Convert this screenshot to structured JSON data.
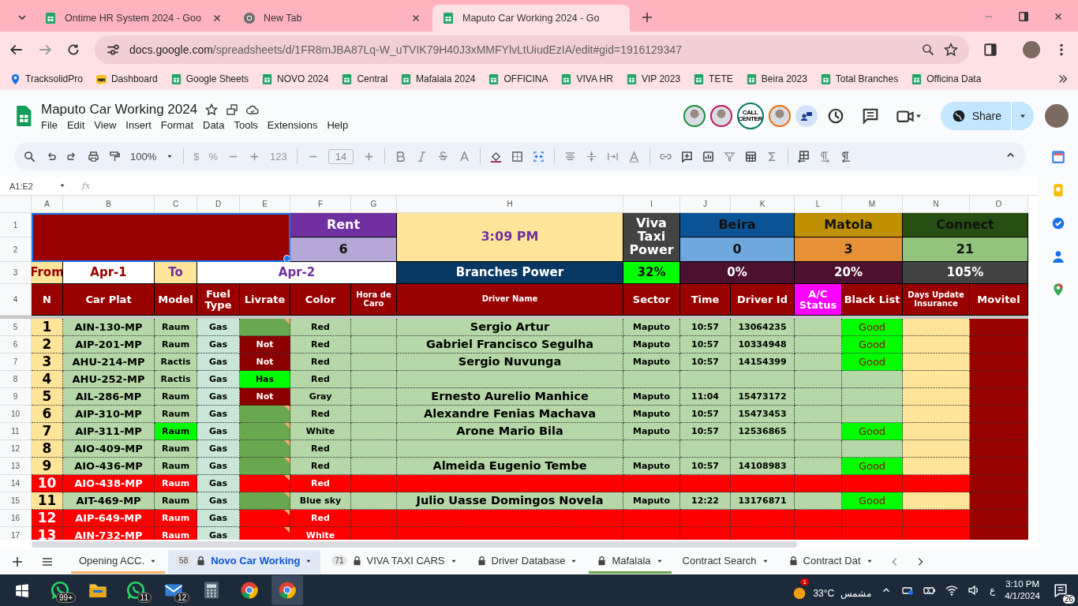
{
  "browser": {
    "tabs": [
      {
        "title": "Ontime HR System 2024 - Goo",
        "kind": "sheets",
        "selected": false
      },
      {
        "title": "New Tab",
        "kind": "chrome",
        "selected": false
      },
      {
        "title": "Maputo Car Working 2024 - Go",
        "kind": "sheets",
        "selected": true
      }
    ],
    "url": {
      "domain": "docs.google.com",
      "path": "/spreadsheets/d/1FR8mJBA87Lq-W_uTVIK79H40J3xMMFYlvLtUiudEzIA/edit#gid=1916129347"
    },
    "bookmarks": [
      {
        "label": "TracksolidPro",
        "kind": "location"
      },
      {
        "label": "Dashboard",
        "kind": "taxi"
      },
      {
        "label": "Google Sheets",
        "kind": "sheets"
      },
      {
        "label": "NOVO 2024",
        "kind": "sheets"
      },
      {
        "label": "Central",
        "kind": "sheets"
      },
      {
        "label": "Mafalala 2024",
        "kind": "sheets"
      },
      {
        "label": "OFFICINA",
        "kind": "sheets"
      },
      {
        "label": "VIVA HR",
        "kind": "sheets"
      },
      {
        "label": "VIP 2023",
        "kind": "sheets"
      },
      {
        "label": "TETE",
        "kind": "sheets"
      },
      {
        "label": "Beira 2023",
        "kind": "sheets"
      },
      {
        "label": "Total Branches",
        "kind": "sheets"
      },
      {
        "label": "Officina Data",
        "kind": "sheets"
      }
    ]
  },
  "doc": {
    "title": "Maputo Car Working 2024",
    "menus": [
      "File",
      "Edit",
      "View",
      "Insert",
      "Format",
      "Data",
      "Tools",
      "Extensions",
      "Help"
    ],
    "collaborators": [
      {
        "kind": "photo",
        "color": "#1e8e3e"
      },
      {
        "kind": "photo",
        "color": "#c2185b"
      },
      {
        "kind": "text",
        "text": "CALL CENTER",
        "color": "#00796b"
      },
      {
        "kind": "photo",
        "color": "#e8710a"
      }
    ],
    "share": "Share"
  },
  "toolbar": {
    "zoom": "100%",
    "currency": "$",
    "percent": "%",
    "number_format": "123",
    "font_size": "14"
  },
  "formula_bar": {
    "name_box": "A1:E2",
    "fx": "fx"
  },
  "sheet": {
    "columns": [
      "A",
      "B",
      "C",
      "D",
      "E",
      "F",
      "G",
      "H",
      "I",
      "J",
      "K",
      "L",
      "M",
      "N",
      "O"
    ],
    "row_numbers": [
      "1",
      "2",
      "3",
      "4",
      "5",
      "6",
      "7",
      "8",
      "9",
      "10",
      "11",
      "12",
      "13",
      "14",
      "15",
      "16",
      "17"
    ],
    "banner": [
      {
        "color": "#990000",
        "selected": true
      },
      {
        "text": "Rent",
        "kind": "light",
        "color": "#7030a0",
        "selected": false
      },
      {
        "text": "3:09 PM",
        "kind": "purple",
        "color": "#ffe599",
        "selected": false
      },
      {
        "text": "Viva Taxi Power",
        "kind": "light",
        "color": "#434343",
        "selected": false
      },
      {
        "text": "Beira",
        "kind": "dark",
        "color": "#0b5394",
        "selected": false
      },
      {
        "text": "Matola",
        "kind": "dark",
        "color": "#bf9000",
        "selected": false
      },
      {
        "text": "Connect",
        "kind": "dark",
        "color": "#274e13",
        "selected": false
      },
      {
        "text": "6",
        "kind": "dark",
        "color": "#b4a7d6",
        "selected": false
      },
      {
        "text": "0",
        "kind": "dark",
        "color": "#6fa8dc",
        "selected": false
      },
      {
        "text": "3",
        "kind": "dark",
        "color": "#e69138",
        "selected": false
      },
      {
        "text": "21",
        "kind": "dark",
        "color": "#93c47d",
        "selected": false
      },
      {
        "text": "From",
        "kind": "red",
        "color": "#ffe599",
        "selected": false
      },
      {
        "text": "Apr-1",
        "kind": "red",
        "color": "#ffffff",
        "selected": false
      },
      {
        "text": "To",
        "kind": "purple",
        "color": "#ffe599",
        "selected": false
      },
      {
        "text": "Apr-2",
        "kind": "purple",
        "color": "#ffffff",
        "selected": false
      },
      {
        "text": "Branches Power",
        "kind": "light",
        "color": "#073763",
        "selected": false
      },
      {
        "text": "32%",
        "kind": "dark",
        "color": "#00ff00",
        "selected": false
      },
      {
        "text": "0%",
        "kind": "light",
        "color": "#4c1130",
        "selected": false
      },
      {
        "text": "20%",
        "kind": "light",
        "color": "#4c1130",
        "selected": false
      },
      {
        "text": "105%",
        "kind": "light",
        "color": "#434343",
        "selected": false
      }
    ],
    "headings": [
      {
        "text": "N",
        "color": "#990000"
      },
      {
        "text": "Car Plat",
        "color": "#990000"
      },
      {
        "text": "Model",
        "color": "#990000"
      },
      {
        "text": "Fuel Type",
        "color": "#990000"
      },
      {
        "text": "Livrate",
        "color": "#990000"
      },
      {
        "text": "Color",
        "color": "#990000"
      },
      {
        "text": "Hora de Caro",
        "color": "#990000"
      },
      {
        "text": "Driver Name",
        "color": "#990000"
      },
      {
        "text": "Sector",
        "color": "#990000"
      },
      {
        "text": "Time",
        "color": "#990000"
      },
      {
        "text": "Driver Id",
        "color": "#990000"
      },
      {
        "text": "A/C Status",
        "color": "#ff00ff"
      },
      {
        "text": "Black List",
        "color": "#990000"
      },
      {
        "text": "Days Update Insurance",
        "color": "#990000"
      },
      {
        "text": "Movitel",
        "color": "#990000"
      }
    ],
    "rows": [
      {
        "n": "1",
        "plate": "AIN-130-MP",
        "model": "Raum",
        "model_highlighted": false,
        "fuel": "Gas",
        "livrate": {
          "kind": "blank",
          "note": true
        },
        "car_color": "Red",
        "driver": "Sergio Artur",
        "sector": "Maputo",
        "time": "10:57",
        "driver_id": "13064235",
        "black_list": "Good",
        "flagged": false
      },
      {
        "n": "2",
        "plate": "AIP-201-MP",
        "model": "Raum",
        "model_highlighted": false,
        "fuel": "Gas",
        "livrate": {
          "kind": "not",
          "text": "Not",
          "note": false
        },
        "car_color": "Red",
        "driver": "Gabriel Francisco Segulha",
        "sector": "Maputo",
        "time": "10:57",
        "driver_id": "10334948",
        "black_list": "Good",
        "flagged": false
      },
      {
        "n": "3",
        "plate": "AHU-214-MP",
        "model": "Ractis",
        "model_highlighted": false,
        "fuel": "Gas",
        "livrate": {
          "kind": "not",
          "text": "Not",
          "note": false
        },
        "car_color": "Red",
        "driver": "Sergio Nuvunga",
        "sector": "Maputo",
        "time": "10:57",
        "driver_id": "14154399",
        "black_list": "Good",
        "flagged": false
      },
      {
        "n": "4",
        "plate": "AHU-252-MP",
        "model": "Ractis",
        "model_highlighted": false,
        "fuel": "Gas",
        "livrate": {
          "kind": "has",
          "text": "Has",
          "note": false
        },
        "car_color": "Red",
        "flagged": false
      },
      {
        "n": "5",
        "plate": "AIL-286-MP",
        "model": "Raum",
        "model_highlighted": false,
        "fuel": "Gas",
        "livrate": {
          "kind": "not",
          "text": "Not",
          "note": false
        },
        "car_color": "Gray",
        "driver": "Ernesto Aurelio Manhice",
        "sector": "Maputo",
        "time": "11:04",
        "driver_id": "15473172",
        "flagged": false
      },
      {
        "n": "6",
        "plate": "AIP-310-MP",
        "model": "Raum",
        "model_highlighted": false,
        "fuel": "Gas",
        "livrate": {
          "kind": "blank",
          "note": true
        },
        "car_color": "Red",
        "driver": "Alexandre Fenias Machava",
        "sector": "Maputo",
        "time": "10:57",
        "driver_id": "15473453",
        "flagged": false
      },
      {
        "n": "7",
        "plate": "AIP-311-MP",
        "model": "Raum",
        "model_highlighted": true,
        "fuel": "Gas",
        "livrate": {
          "kind": "blank",
          "note": true
        },
        "car_color": "White",
        "driver": "Arone Mario Bila",
        "sector": "Maputo",
        "time": "10:57",
        "driver_id": "12536865",
        "black_list": "Good",
        "flagged": false
      },
      {
        "n": "8",
        "plate": "AIO-409-MP",
        "model": "Raum",
        "model_highlighted": false,
        "fuel": "Gas",
        "livrate": {
          "kind": "blank",
          "note": true
        },
        "car_color": "Red",
        "flagged": false
      },
      {
        "n": "9",
        "plate": "AIO-436-MP",
        "model": "Raum",
        "model_highlighted": false,
        "fuel": "Gas",
        "livrate": {
          "kind": "blank",
          "note": true
        },
        "car_color": "Red",
        "driver": "Almeida Eugenio Tembe",
        "sector": "Maputo",
        "time": "10:57",
        "driver_id": "14108983",
        "black_list": "Good",
        "flagged": false
      },
      {
        "n": "10",
        "plate": "AIO-438-MP",
        "model": "Raum",
        "model_highlighted": false,
        "fuel": "Gas",
        "livrate": {
          "kind": "blank",
          "note": true
        },
        "car_color": "Red",
        "flagged": true
      },
      {
        "n": "11",
        "plate": "AIT-469-MP",
        "model": "Raum",
        "model_highlighted": false,
        "fuel": "Gas",
        "livrate": {
          "kind": "blank",
          "note": true
        },
        "car_color": "Blue sky",
        "driver": "Julio Uasse Domingos Novela",
        "sector": "Maputo",
        "time": "12:22",
        "driver_id": "13176871",
        "black_list": "Good",
        "flagged": false
      },
      {
        "n": "12",
        "plate": "AIP-649-MP",
        "model": "Raum",
        "model_highlighted": false,
        "fuel": "Gas",
        "livrate": {
          "kind": "blank",
          "note": true
        },
        "car_color": "Red",
        "flagged": true
      },
      {
        "n": "13",
        "plate": "AIN-732-MP",
        "model": "Raum",
        "model_highlighted": false,
        "fuel": "Gas",
        "livrate": {
          "kind": "blank",
          "note": true
        },
        "car_color": "White",
        "flagged": true
      }
    ]
  },
  "sheet_tabs": [
    {
      "label": "Opening ACC.",
      "locked": false,
      "color": "#f6b26b",
      "selected": false
    },
    {
      "label": "Novo Car Working",
      "badge": "58",
      "locked": true,
      "selected": true
    },
    {
      "label": "VIVA TAXI CARS",
      "badge": "71",
      "locked": true,
      "selected": false
    },
    {
      "label": "Driver Database",
      "locked": true,
      "selected": false
    },
    {
      "label": "Mafalala",
      "locked": true,
      "color": "#6aa84f",
      "selected": false
    },
    {
      "label": "Contract Search",
      "locked": false,
      "selected": false
    },
    {
      "label": "Contract Dat",
      "locked": true,
      "selected": false
    }
  ],
  "taskbar": {
    "apps": [
      {
        "kind": "whatsapp",
        "badge": "99+",
        "selected": false
      },
      {
        "kind": "folder",
        "selected": false
      },
      {
        "kind": "whatsapp",
        "badge": "11",
        "selected": false
      },
      {
        "kind": "mail",
        "badge": "12",
        "selected": false
      },
      {
        "kind": "calculator",
        "selected": false
      },
      {
        "kind": "chrome",
        "selected": false
      },
      {
        "kind": "chrome",
        "selected": true
      }
    ],
    "weather": {
      "badge": "1",
      "temperature": "33°C",
      "condition": "مشمس"
    },
    "language": "ع",
    "time": "3:10 PM",
    "date": "4/1/2024",
    "notifications": "26"
  }
}
